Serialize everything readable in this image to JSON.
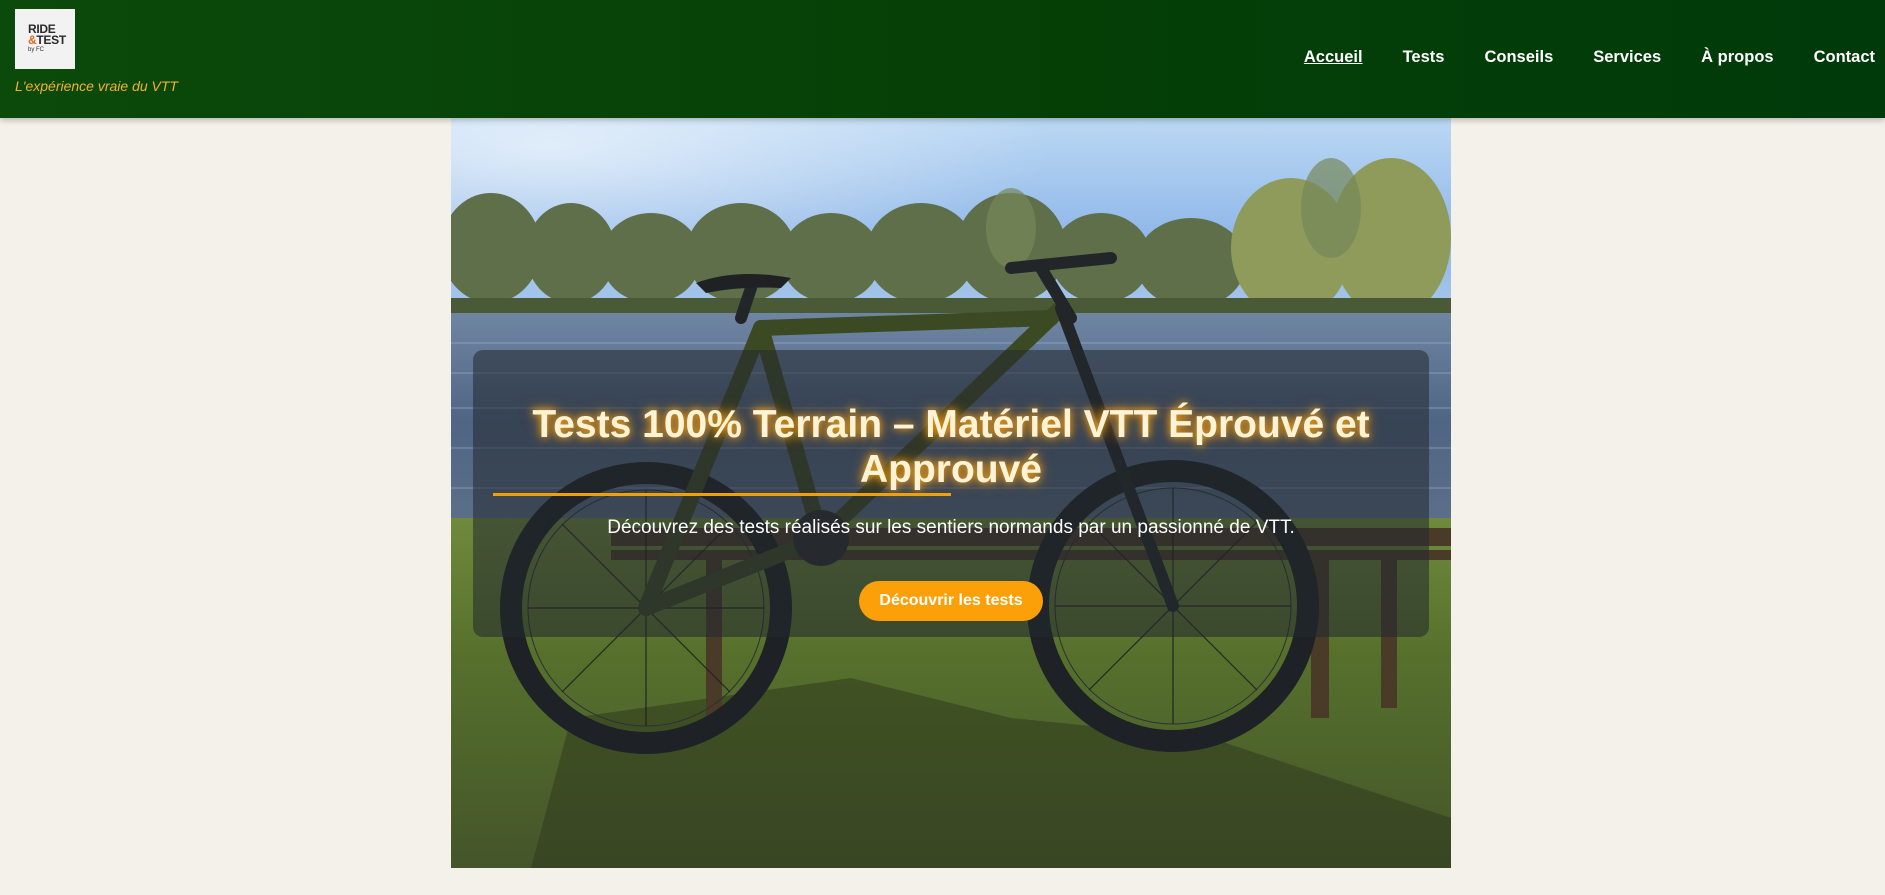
{
  "brand": {
    "logo_line1": "RIDE",
    "logo_amp": "&",
    "logo_line2": "TEST",
    "logo_small": "by FC",
    "tagline": "L'expérience vraie du VTT"
  },
  "nav": {
    "items": [
      {
        "label": "Accueil",
        "active": true
      },
      {
        "label": "Tests"
      },
      {
        "label": "Conseils"
      },
      {
        "label": "Services"
      },
      {
        "label": "À propos"
      },
      {
        "label": "Contact"
      }
    ]
  },
  "hero": {
    "title": "Tests 100% Terrain – Matériel VTT Éprouvé et Approuvé",
    "subtitle": "Découvrez des tests réalisés sur les sentiers normands par un passionné de VTT.",
    "cta_label": "Découvrir les tests",
    "image_subject": "mountain-bike-by-lake-photo"
  },
  "colors": {
    "header_green": "#064006",
    "accent_orange": "#fca00a",
    "tagline_gold": "#f3b12a",
    "page_bg": "#f4f0ea"
  }
}
